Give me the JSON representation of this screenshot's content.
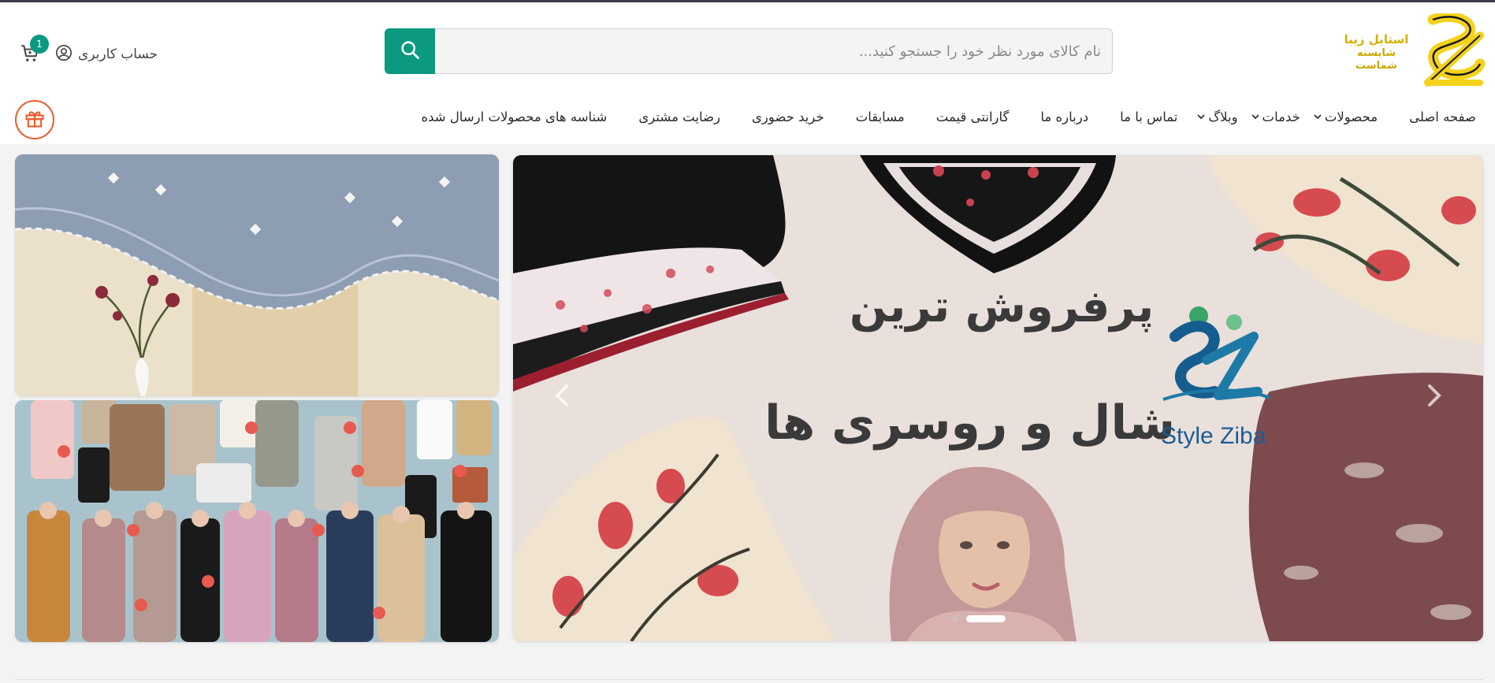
{
  "brand": {
    "logo_text_line1": "استایل زیبا",
    "logo_text_line2": "شایسته شماست"
  },
  "search": {
    "placeholder": "نام کالای مورد نظر خود را جستجو کنید..."
  },
  "account": {
    "label": "حساب کاربری"
  },
  "cart": {
    "count": "1"
  },
  "nav": {
    "items": [
      {
        "label": "صفحه اصلی",
        "dropdown": false
      },
      {
        "label": "محصولات",
        "dropdown": true
      },
      {
        "label": "خدمات",
        "dropdown": true
      },
      {
        "label": "وبلاگ",
        "dropdown": true
      },
      {
        "label": "تماس با ما",
        "dropdown": false
      },
      {
        "label": "درباره ما",
        "dropdown": false
      },
      {
        "label": "گارانتی قیمت",
        "dropdown": false
      },
      {
        "label": "مسابقات",
        "dropdown": false
      },
      {
        "label": "خرید حضوری",
        "dropdown": false
      },
      {
        "label": "رضایت مشتری",
        "dropdown": false
      },
      {
        "label": "شناسه های محصولات ارسال شده",
        "dropdown": false
      }
    ]
  },
  "banner": {
    "headline_line1": "پرفروش ترین",
    "headline_line2": "شال و روسری ها",
    "brand_name": "Style Ziba",
    "slides": 2,
    "active_slide": 2
  },
  "colors": {
    "accent": "#0b9a80",
    "gift": "#f0592a",
    "logo_yellow": "#f4d21b"
  },
  "icons": [
    "search-icon",
    "user-icon",
    "cart-icon",
    "gift-icon",
    "chevron-down-icon",
    "chevron-left-icon",
    "chevron-right-icon"
  ]
}
